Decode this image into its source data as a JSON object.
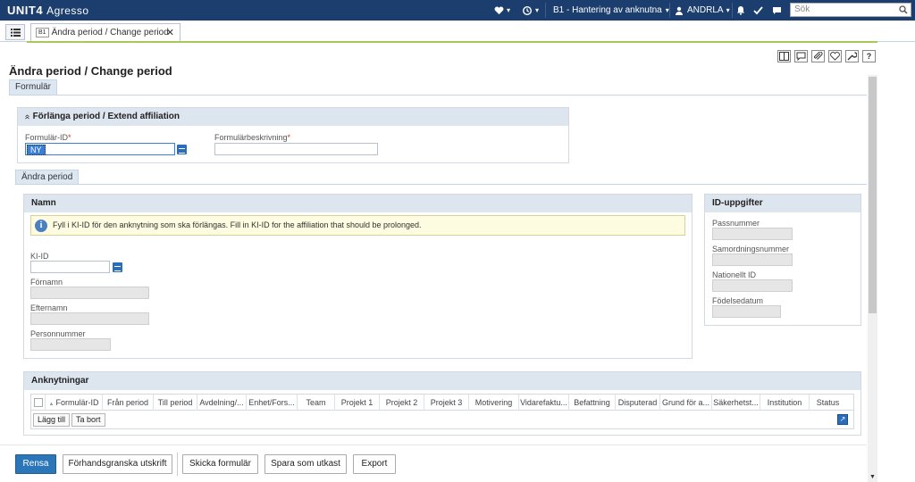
{
  "topbar": {
    "brand_bold": "UNIT4",
    "brand_light": "Agresso",
    "menu_title": "B1 - Hantering av anknutna",
    "user": "ANDRLA",
    "search_placeholder": "Sök",
    "heart_chevron": "▾",
    "history_chevron": "▾",
    "menu_chevron": "▾",
    "user_chevron": "▾"
  },
  "tabs": {
    "open_tab_badge": "B1",
    "open_tab_label": "Ändra period / Change period",
    "close_glyph": "✕"
  },
  "page": {
    "title": "Ändra period / Change period",
    "section_tab": "Formulär"
  },
  "formular_panel": {
    "header": "Förlänga period / Extend affiliation",
    "header_glyph": "»",
    "form_id_label": "Formulär-ID",
    "form_id_value": "NY",
    "form_desc_label": "Formulärbeskrivning",
    "required_mark": "*"
  },
  "sub_tab": "Ändra period",
  "namn_panel": {
    "header": "Namn",
    "info_text": "Fyll i KI-ID för den anknytning som ska förlängas. Fill in KI-ID for the affiliation that should be prolonged.",
    "info_icon": "i",
    "ki_id_label": "KI-ID",
    "fornamn_label": "Förnamn",
    "efternamn_label": "Efternamn",
    "personnummer_label": "Personnummer"
  },
  "id_panel": {
    "header": "ID-uppgifter",
    "passnummer_label": "Passnummer",
    "samordning_label": "Samordningsnummer",
    "nationellt_label": "Nationellt ID",
    "fodelse_label": "Födelsedatum"
  },
  "anknytningar": {
    "header": "Anknytningar",
    "sort_glyph": "▲",
    "columns": [
      "Formulär-ID",
      "Från period",
      "Till period",
      "Avdelning/...",
      "Enhet/Fors...",
      "Team",
      "Projekt 1",
      "Projekt 2",
      "Projekt 3",
      "Motivering",
      "Vidarefaktu...",
      "Befattning",
      "Disputerad",
      "Grund för a...",
      "Säkerhetst...",
      "Institution",
      "Status"
    ],
    "add_label": "Lägg till",
    "remove_label": "Ta bort"
  },
  "bottom": {
    "rensa": "Rensa",
    "preview": "Förhandsgranska utskrift",
    "send": "Skicka formulär",
    "save_draft": "Spara som utkast",
    "export": "Export"
  },
  "colors": {
    "topbar": "#1c3e6e",
    "accent": "#2a76b8",
    "panel_header": "#dde5ef",
    "tab_underline": "#a8c85a"
  }
}
